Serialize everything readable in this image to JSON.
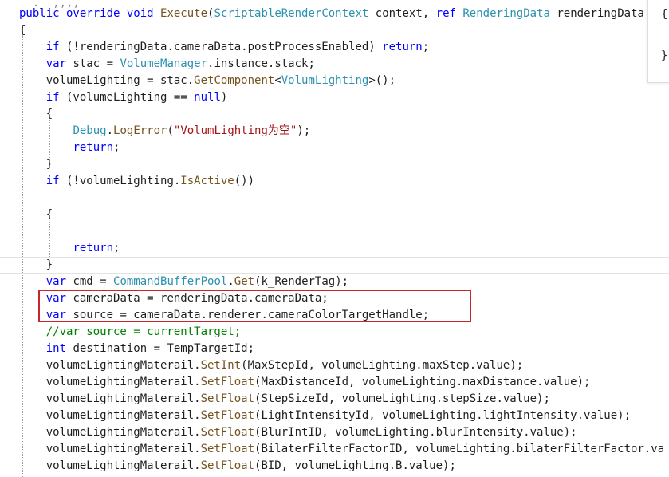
{
  "lines": [
    [
      {
        "t": "  .  ,,,,",
        "c": "faded"
      }
    ],
    [
      {
        "t": "public override void ",
        "c": "kw"
      },
      {
        "t": "Execute",
        "c": "mt"
      },
      {
        "t": "("
      },
      {
        "t": "ScriptableRenderContext",
        "c": "ty"
      },
      {
        "t": " context, "
      },
      {
        "t": "ref ",
        "c": "kw"
      },
      {
        "t": "RenderingData",
        "c": "ty"
      },
      {
        "t": " renderingData"
      }
    ],
    [
      {
        "t": "{"
      }
    ],
    [
      {
        "t": "    "
      },
      {
        "t": "if",
        "c": "kw"
      },
      {
        "t": " (!renderingData.cameraData.postProcessEnabled) "
      },
      {
        "t": "return",
        "c": "kw"
      },
      {
        "t": ";"
      }
    ],
    [
      {
        "t": "    "
      },
      {
        "t": "var",
        "c": "kw"
      },
      {
        "t": " stac = "
      },
      {
        "t": "VolumeManager",
        "c": "ty"
      },
      {
        "t": ".instance.stack;"
      }
    ],
    [
      {
        "t": "    volumeLighting = stac."
      },
      {
        "t": "GetComponent",
        "c": "mt"
      },
      {
        "t": "<"
      },
      {
        "t": "VolumLighting",
        "c": "ty"
      },
      {
        "t": ">();"
      }
    ],
    [
      {
        "t": "    "
      },
      {
        "t": "if",
        "c": "kw"
      },
      {
        "t": " (volumeLighting == "
      },
      {
        "t": "null",
        "c": "kw"
      },
      {
        "t": ")"
      }
    ],
    [
      {
        "t": "    {"
      }
    ],
    [
      {
        "t": "        "
      },
      {
        "t": "Debug",
        "c": "ty"
      },
      {
        "t": "."
      },
      {
        "t": "LogError",
        "c": "mt"
      },
      {
        "t": "("
      },
      {
        "t": "\"VolumLighting为空\"",
        "c": "str"
      },
      {
        "t": ");"
      }
    ],
    [
      {
        "t": "        "
      },
      {
        "t": "return",
        "c": "kw"
      },
      {
        "t": ";"
      }
    ],
    [
      {
        "t": "    }"
      }
    ],
    [
      {
        "t": "    "
      },
      {
        "t": "if",
        "c": "kw"
      },
      {
        "t": " (!volumeLighting."
      },
      {
        "t": "IsActive",
        "c": "mt"
      },
      {
        "t": "())"
      }
    ],
    [
      {
        "t": ""
      }
    ],
    [
      {
        "t": "    {"
      }
    ],
    [
      {
        "t": ""
      }
    ],
    [
      {
        "t": "        "
      },
      {
        "t": "return",
        "c": "kw"
      },
      {
        "t": ";"
      }
    ],
    [
      {
        "t": "    }"
      }
    ],
    [
      {
        "t": "    "
      },
      {
        "t": "var",
        "c": "kw"
      },
      {
        "t": " cmd = "
      },
      {
        "t": "CommandBufferPool",
        "c": "ty"
      },
      {
        "t": "."
      },
      {
        "t": "Get",
        "c": "mt"
      },
      {
        "t": "(k_RenderTag);"
      }
    ],
    [
      {
        "t": "    "
      },
      {
        "t": "var",
        "c": "kw"
      },
      {
        "t": " cameraData = renderingData.cameraData;"
      }
    ],
    [
      {
        "t": "    "
      },
      {
        "t": "var",
        "c": "kw"
      },
      {
        "t": " source = cameraData.renderer.cameraColorTargetHandle;"
      }
    ],
    [
      {
        "t": "    //var source = currentTarget;",
        "c": "cm"
      }
    ],
    [
      {
        "t": "    "
      },
      {
        "t": "int",
        "c": "kw"
      },
      {
        "t": " destination = TempTargetId;"
      }
    ],
    [
      {
        "t": "    volumeLightingMaterail."
      },
      {
        "t": "SetInt",
        "c": "mt"
      },
      {
        "t": "(MaxStepId, volumeLighting.maxStep.value);"
      }
    ],
    [
      {
        "t": "    volumeLightingMaterail."
      },
      {
        "t": "SetFloat",
        "c": "mt"
      },
      {
        "t": "(MaxDistanceId, volumeLighting.maxDistance.value);"
      }
    ],
    [
      {
        "t": "    volumeLightingMaterail."
      },
      {
        "t": "SetFloat",
        "c": "mt"
      },
      {
        "t": "(StepSizeId, volumeLighting.stepSize.value);"
      }
    ],
    [
      {
        "t": "    volumeLightingMaterail."
      },
      {
        "t": "SetFloat",
        "c": "mt"
      },
      {
        "t": "(LightIntensityId, volumeLighting.lightIntensity.value);"
      }
    ],
    [
      {
        "t": "    volumeLightingMaterail."
      },
      {
        "t": "SetFloat",
        "c": "mt"
      },
      {
        "t": "(BlurIntID, volumeLighting.blurIntensity.value);"
      }
    ],
    [
      {
        "t": "    volumeLightingMaterail."
      },
      {
        "t": "SetFloat",
        "c": "mt"
      },
      {
        "t": "(BilaterFilterFactorID, volumeLighting.bilaterFilterFactor.va"
      }
    ],
    [
      {
        "t": "    volumeLightingMaterail."
      },
      {
        "t": "SetFloat",
        "c": "mt"
      },
      {
        "t": "(BID, volumeLighting.B.value);"
      }
    ]
  ],
  "side_panel": [
    "{",
    "}"
  ]
}
